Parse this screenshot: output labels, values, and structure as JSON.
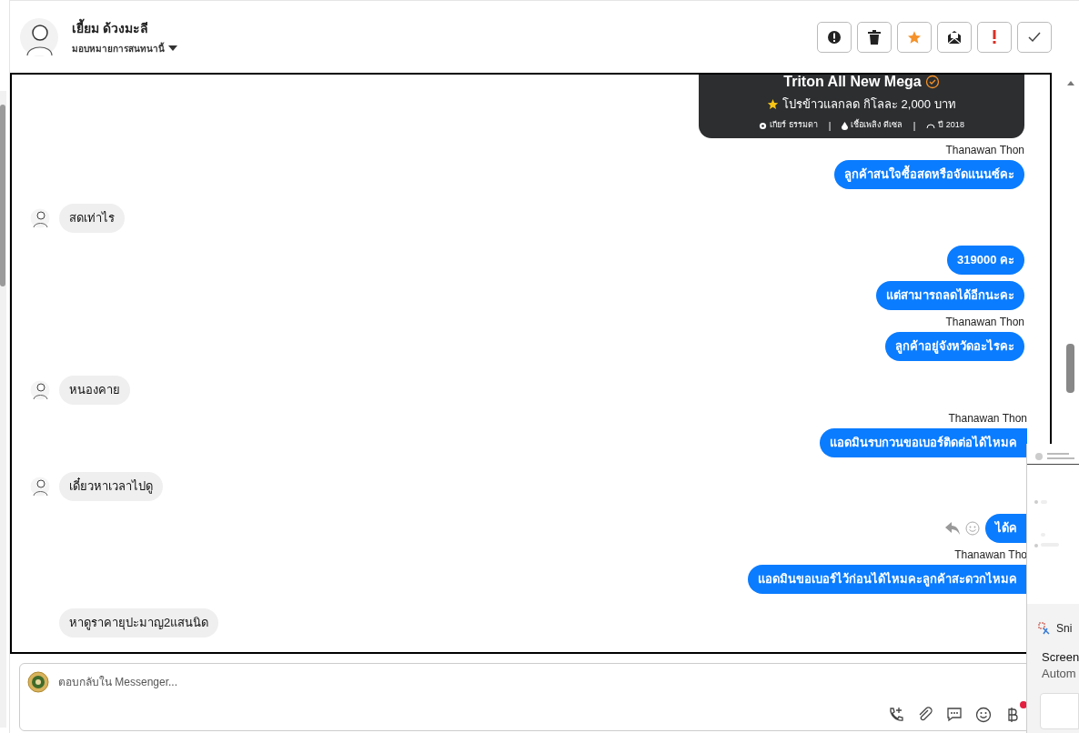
{
  "header": {
    "name": "เยี้ยม ด้วงมะลี",
    "assign": "มอบหมายการสนทนานี้"
  },
  "actions": [
    {
      "kind": "alert"
    },
    {
      "kind": "trash"
    },
    {
      "kind": "star"
    },
    {
      "kind": "mail"
    },
    {
      "kind": "important"
    },
    {
      "kind": "done"
    }
  ],
  "product_card": {
    "title": "Triton All New Mega",
    "promo": "โปรข้าวแลกลด กิโลละ 2,000 บาท",
    "specs": [
      {
        "kind": "gear",
        "text": "เกียร์ ธรรมดา"
      },
      {
        "kind": "fuel",
        "text": "เชื้อเพลิง ดีเซล"
      },
      {
        "kind": "year",
        "text": "ปี 2018"
      }
    ],
    "separator": "|"
  },
  "messages": [
    {
      "kind": "out",
      "sender": "Thanawan Thon",
      "text": "ลูกค้าสนใจซื้อสดหรือจัดแนนซ์คะ",
      "cut": false
    },
    {
      "kind": "in",
      "text": "สดเท่าไร",
      "avatar": true
    },
    {
      "kind": "out",
      "text": "319000 คะ",
      "cut": false
    },
    {
      "kind": "out",
      "text": "แต่สามารถลดได้อีกนะคะ",
      "cut": false
    },
    {
      "kind": "out",
      "sender": "Thanawan Thon",
      "text": "ลูกค้าอยู่จังหวัดอะไรคะ",
      "cut": false
    },
    {
      "kind": "in",
      "text": "หนองคาย",
      "avatar": true
    },
    {
      "kind": "out",
      "sender": "Thanawan Thon",
      "text": "แอดมินรบกวนขอเบอร์ติดต่อได้ไหมค",
      "cut": true
    },
    {
      "kind": "in",
      "text": "เดี๋ยวหาเวลาไปดู",
      "avatar": true
    },
    {
      "kind": "out",
      "text": "ได้ค",
      "cut": true,
      "hover_actions": true
    },
    {
      "kind": "out",
      "sender": "Thanawan Tho",
      "text": "แอดมินขอเบอร์ไว้ก่อนได้ไหมคะลูกค้าสะดวกไหมค",
      "cut": true
    },
    {
      "kind": "in",
      "text": "หาดูราคายุปะมาญ2แสนนิด",
      "avatar": false
    }
  ],
  "composer": {
    "placeholder": "ตอบกลับใน Messenger...",
    "tools": [
      {
        "kind": "call"
      },
      {
        "kind": "attach"
      },
      {
        "kind": "chat"
      },
      {
        "kind": "emoji"
      },
      {
        "kind": "baht",
        "badge": true
      }
    ]
  },
  "notification": {
    "app": "Sni",
    "title": "Screen",
    "subtitle": "Autom"
  }
}
